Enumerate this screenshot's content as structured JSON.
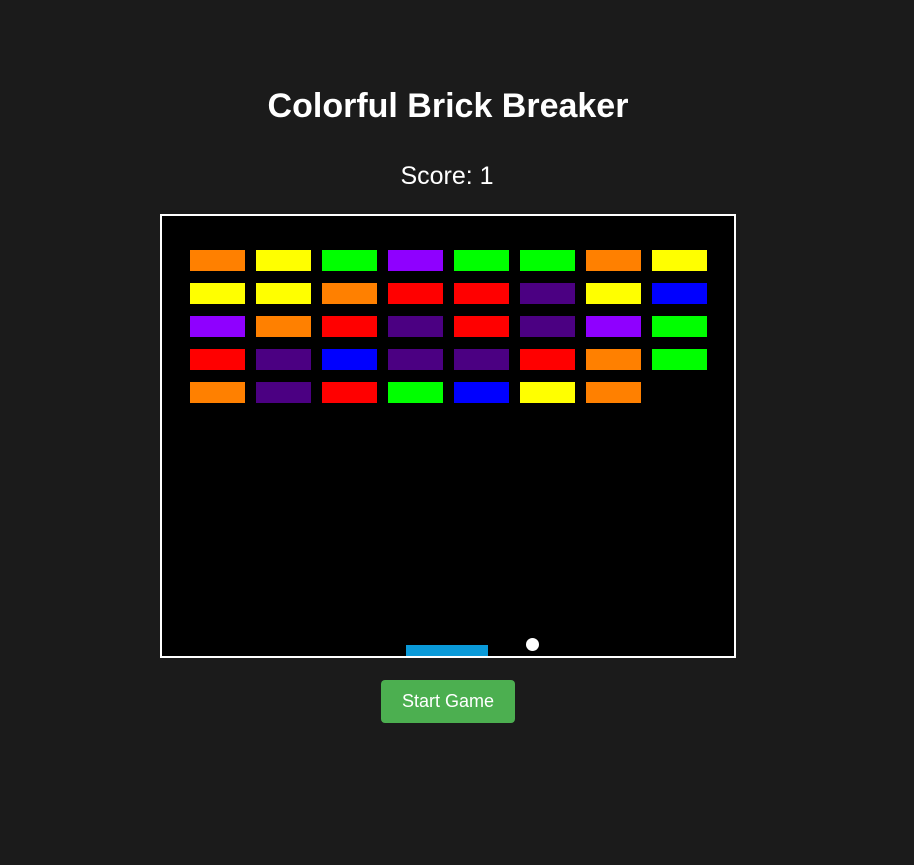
{
  "title": "Colorful Brick Breaker",
  "score_label": "Score: 1",
  "score": 1,
  "start_button_label": "Start Game",
  "colors": {
    "page_background": "#1b1b1b",
    "board_background": "#000000",
    "board_border": "#ffffff",
    "paddle": "#0a9ad9",
    "ball": "#ffffff",
    "start_button": "#4caf50"
  },
  "brick_palette": {
    "orange": "#ff8000",
    "yellow": "#ffff00",
    "green": "#00ff00",
    "violet": "#8f00ff",
    "red": "#ff0000",
    "indigo": "#4b0082",
    "blue": "#0000ff"
  },
  "bricks": [
    [
      "orange",
      "yellow",
      "green",
      "violet",
      "green",
      "green",
      "orange",
      "yellow"
    ],
    [
      "yellow",
      "yellow",
      "orange",
      "red",
      "red",
      "indigo",
      "yellow",
      "blue"
    ],
    [
      "violet",
      "orange",
      "red",
      "indigo",
      "red",
      "indigo",
      "violet",
      "green"
    ],
    [
      "red",
      "indigo",
      "blue",
      "indigo",
      "indigo",
      "red",
      "orange",
      "green"
    ],
    [
      "orange",
      "indigo",
      "red",
      "green",
      "blue",
      "yellow",
      "orange",
      null
    ]
  ]
}
